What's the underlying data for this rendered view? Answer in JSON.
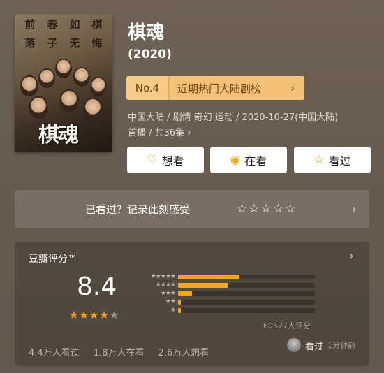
{
  "poster": {
    "top_text": [
      "前",
      "春",
      "如",
      "棋",
      "落",
      "子",
      "无",
      "悔"
    ],
    "title": "棋魂"
  },
  "show": {
    "title": "棋魂",
    "year": "(2020)"
  },
  "ranking": {
    "number": "No.4",
    "label": "近期热门大陆剧榜",
    "chevron_icon": "chevron-right-icon"
  },
  "meta": {
    "line1": "中国大陆 / 剧情 奇幻 运动 / 2020-10-27(中国大陆)",
    "line2": "首播 / 共36集 ›"
  },
  "actions": {
    "want": {
      "label": "想看",
      "icon": "heart-add-icon"
    },
    "watching": {
      "label": "在看",
      "icon": "target-icon"
    },
    "watched": {
      "label": "看过",
      "icon": "star-outline-icon"
    }
  },
  "watched_prompt": {
    "label": "已看过？记录此刻感受",
    "stars": "☆☆☆☆☆",
    "chevron": "›"
  },
  "rating": {
    "title": "豆瓣评分™",
    "score": "8.4",
    "stars_on": "★★★★",
    "stars_off": "★",
    "distribution_labels": [
      "★★★★★",
      "★★★★",
      "★★★",
      "★★",
      "★"
    ],
    "distribution_fraction": [
      0.45,
      0.36,
      0.1,
      0.02,
      0.02
    ],
    "count_text": "60527人评分",
    "stats": [
      "4.4万人看过",
      "1.8万人在看",
      "2.6万人想看"
    ],
    "recent": {
      "action": "看过",
      "time": "1分钟前"
    },
    "accent_color": "#f3a51f"
  }
}
